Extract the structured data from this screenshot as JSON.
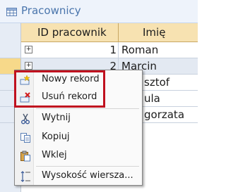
{
  "window": {
    "title": "Pracownicy",
    "icon": "table-icon"
  },
  "table": {
    "columns": [
      "ID pracownik",
      "Imię"
    ],
    "rows": [
      {
        "id": "1",
        "name": "Roman"
      },
      {
        "id": "2",
        "name": "Marcin"
      },
      {
        "id": "",
        "name": "sztof"
      },
      {
        "id": "",
        "name": "ula"
      },
      {
        "id": "",
        "name": "gorzata"
      }
    ]
  },
  "context_menu": {
    "items": [
      {
        "label": "Nowy rekord",
        "icon": "new-record-icon"
      },
      {
        "label": "Usuń rekord",
        "icon": "delete-record-icon"
      },
      {
        "label": "Wytnij",
        "icon": "scissors-icon"
      },
      {
        "label": "Kopiuj",
        "icon": "copy-icon"
      },
      {
        "label": "Wklej",
        "icon": "paste-icon"
      },
      {
        "label": "Wysokość wiersza...",
        "icon": "row-height-icon"
      }
    ]
  },
  "colors": {
    "header_bg": "#f7e2b1",
    "highlight": "#c0111f",
    "title": "#4a75ac"
  }
}
